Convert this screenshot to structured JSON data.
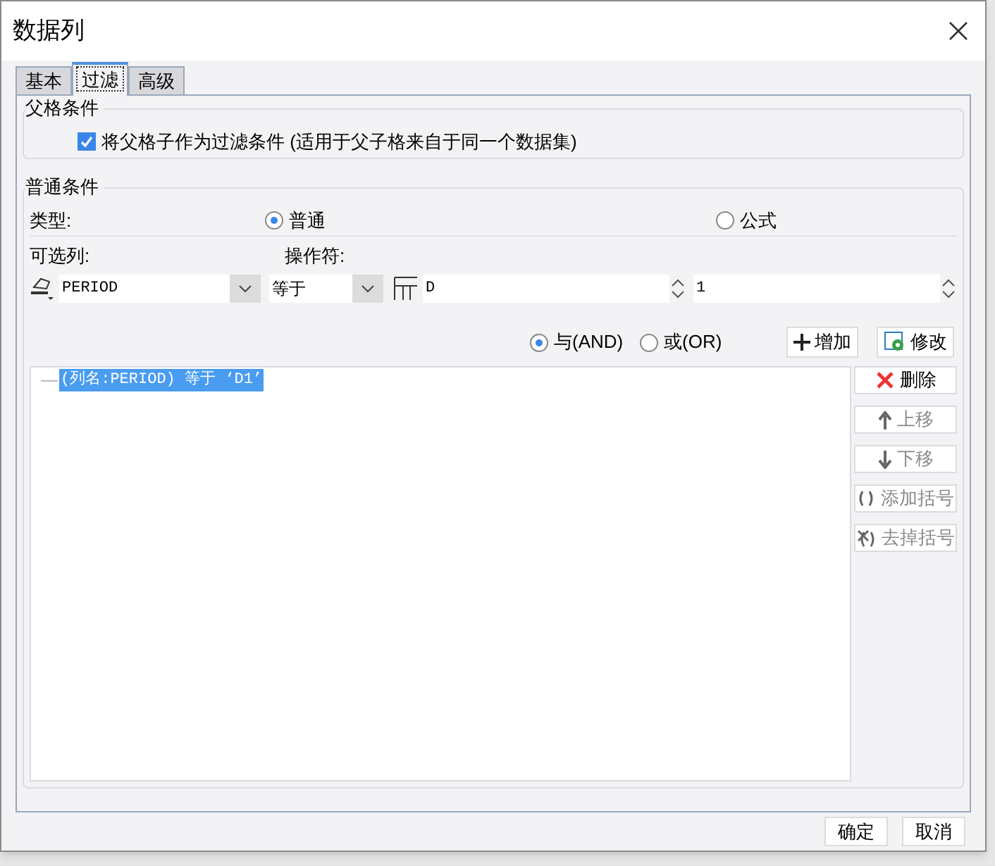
{
  "window": {
    "title": "数据列"
  },
  "tabs": [
    {
      "label": "基本",
      "selected": false
    },
    {
      "label": "过滤",
      "selected": true
    },
    {
      "label": "高级",
      "selected": false
    }
  ],
  "parent_condition": {
    "title": "父格条件",
    "checkbox": {
      "label": "将父格子作为过滤条件 (适用于父子格来自于同一个数据集)",
      "checked": true
    }
  },
  "normal_condition": {
    "title": "普通条件",
    "type_label": "类型:",
    "type_options": [
      {
        "label": "普通",
        "selected": true
      },
      {
        "label": "公式",
        "selected": false
      }
    ],
    "column_label": "可选列:",
    "operator_label": "操作符:",
    "column_value": "PERIOD",
    "operator_value": "等于",
    "value_1": "D",
    "value_2": "1",
    "logic_options": [
      {
        "label": "与(AND)",
        "selected": true
      },
      {
        "label": "或(OR)",
        "selected": false
      }
    ],
    "add_button": "增加",
    "modify_button": "修改",
    "conditions": [
      {
        "text": "(列名:PERIOD) 等于 ‘D1’",
        "selected": true
      }
    ],
    "side_buttons": [
      {
        "label": "删除",
        "kind": "delete",
        "disabled": false
      },
      {
        "label": "上移",
        "kind": "up",
        "disabled": true
      },
      {
        "label": "下移",
        "kind": "down",
        "disabled": true
      },
      {
        "label": "添加括号",
        "kind": "add-paren",
        "disabled": true
      },
      {
        "label": "去掉括号",
        "kind": "remove-paren",
        "disabled": true
      }
    ]
  },
  "buttons": [
    "确定",
    "取消"
  ]
}
